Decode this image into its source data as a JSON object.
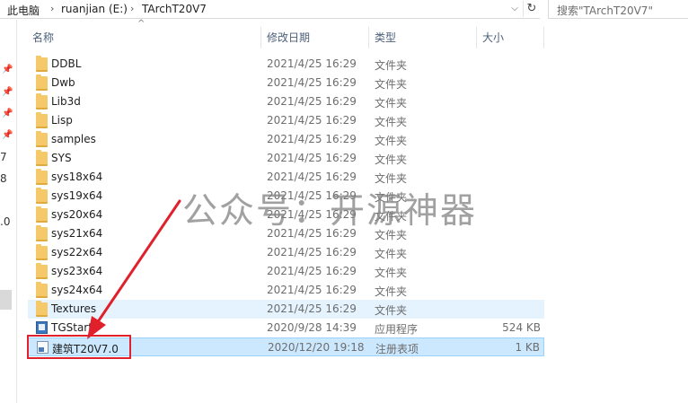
{
  "address": {
    "crumbs": [
      "此电脑",
      "ruanjian (E:)",
      "TArchT20V7"
    ],
    "search_placeholder": "搜索\"TArchT20V7\""
  },
  "nav_pane_fragments": [
    "7",
    "8",
    ".0"
  ],
  "columns": {
    "name": "名称",
    "date": "修改日期",
    "type": "类型",
    "size": "大小"
  },
  "files": [
    {
      "name": "DDBL",
      "date": "2021/4/25 16:29",
      "type": "文件夹",
      "size": "",
      "icon": "folder-icon"
    },
    {
      "name": "Dwb",
      "date": "2021/4/25 16:29",
      "type": "文件夹",
      "size": "",
      "icon": "folder-icon"
    },
    {
      "name": "Lib3d",
      "date": "2021/4/25 16:29",
      "type": "文件夹",
      "size": "",
      "icon": "folder-icon"
    },
    {
      "name": "Lisp",
      "date": "2021/4/25 16:29",
      "type": "文件夹",
      "size": "",
      "icon": "folder-icon"
    },
    {
      "name": "samples",
      "date": "2021/4/25 16:29",
      "type": "文件夹",
      "size": "",
      "icon": "folder-icon"
    },
    {
      "name": "SYS",
      "date": "2021/4/25 16:29",
      "type": "文件夹",
      "size": "",
      "icon": "folder-icon"
    },
    {
      "name": "sys18x64",
      "date": "2021/4/25 16:29",
      "type": "文件夹",
      "size": "",
      "icon": "folder-icon"
    },
    {
      "name": "sys19x64",
      "date": "2021/4/25 16:29",
      "type": "文件夹",
      "size": "",
      "icon": "folder-icon"
    },
    {
      "name": "sys20x64",
      "date": "2021/4/25 16:29",
      "type": "文件夹",
      "size": "",
      "icon": "folder-icon"
    },
    {
      "name": "sys21x64",
      "date": "2021/4/25 16:29",
      "type": "文件夹",
      "size": "",
      "icon": "folder-icon"
    },
    {
      "name": "sys22x64",
      "date": "2021/4/25 16:29",
      "type": "文件夹",
      "size": "",
      "icon": "folder-icon"
    },
    {
      "name": "sys23x64",
      "date": "2021/4/25 16:29",
      "type": "文件夹",
      "size": "",
      "icon": "folder-icon"
    },
    {
      "name": "sys24x64",
      "date": "2021/4/25 16:29",
      "type": "文件夹",
      "size": "",
      "icon": "folder-icon"
    },
    {
      "name": "Textures",
      "date": "2021/4/25 16:29",
      "type": "文件夹",
      "size": "",
      "icon": "folder-icon"
    },
    {
      "name": "TGStart",
      "date": "2020/9/28 14:39",
      "type": "应用程序",
      "size": "524 KB",
      "icon": "app-icon"
    },
    {
      "name": "建筑T20V7.0",
      "date": "2020/12/20 19:18",
      "type": "注册表项",
      "size": "1 KB",
      "icon": "registry-file-icon"
    }
  ],
  "watermark": "公众号：开源神器",
  "colors": {
    "annotation": "#e0202a",
    "selected_row": "#cce8ff",
    "hover_row": "#e5f3ff"
  }
}
